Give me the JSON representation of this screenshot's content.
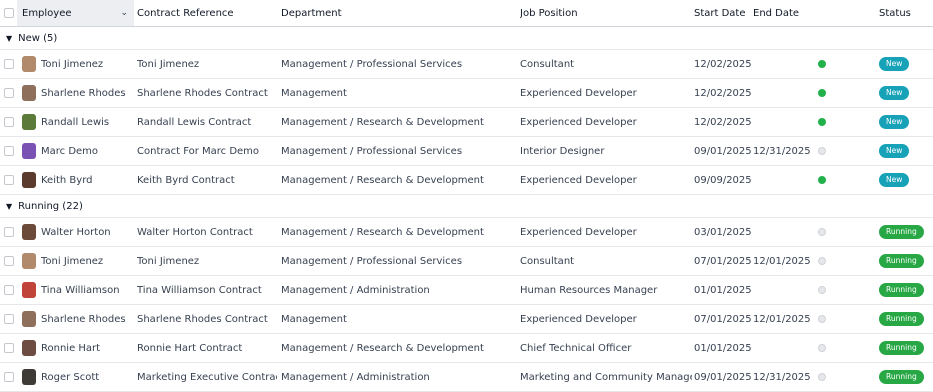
{
  "columns": {
    "employee": "Employee",
    "contract_reference": "Contract Reference",
    "department": "Department",
    "job_position": "Job Position",
    "start_date": "Start Date",
    "end_date": "End Date",
    "status": "Status"
  },
  "colors": {
    "new_badge": "#17a2b8",
    "running_badge": "#28a745",
    "dot_green": "#21b04a",
    "dot_grey": "#e5e7eb"
  },
  "groups": [
    {
      "label": "New (5)",
      "rows": [
        {
          "employee": "Toni Jimenez",
          "avatar_color": "#b08a6a",
          "contract": "Toni Jimenez",
          "department": "Management / Professional Services",
          "job": "Consultant",
          "start": "12/02/2025",
          "end": "",
          "kanban": "green",
          "status": "New"
        },
        {
          "employee": "Sharlene Rhodes",
          "avatar_color": "#8e6f5c",
          "contract": "Sharlene Rhodes Contract",
          "department": "Management",
          "job": "Experienced Developer",
          "start": "12/02/2025",
          "end": "",
          "kanban": "green",
          "status": "New"
        },
        {
          "employee": "Randall Lewis",
          "avatar_color": "#5c7a3a",
          "contract": "Randall Lewis Contract",
          "department": "Management / Research & Development",
          "job": "Experienced Developer",
          "start": "12/02/2025",
          "end": "",
          "kanban": "green",
          "status": "New"
        },
        {
          "employee": "Marc Demo",
          "avatar_color": "#7a52b3",
          "contract": "Contract For Marc Demo",
          "department": "Management / Professional Services",
          "job": "Interior Designer",
          "start": "09/01/2025",
          "end": "12/31/2025",
          "kanban": "grey",
          "status": "New"
        },
        {
          "employee": "Keith Byrd",
          "avatar_color": "#5a3b2e",
          "contract": "Keith Byrd Contract",
          "department": "Management / Research & Development",
          "job": "Experienced Developer",
          "start": "09/09/2025",
          "end": "",
          "kanban": "green",
          "status": "New"
        }
      ]
    },
    {
      "label": "Running (22)",
      "rows": [
        {
          "employee": "Walter Horton",
          "avatar_color": "#6b4a3a",
          "contract": "Walter Horton Contract",
          "department": "Management / Research & Development",
          "job": "Experienced Developer",
          "start": "03/01/2025",
          "end": "",
          "kanban": "grey",
          "status": "Running"
        },
        {
          "employee": "Toni Jimenez",
          "avatar_color": "#b08a6a",
          "contract": "Toni Jimenez",
          "department": "Management / Professional Services",
          "job": "Consultant",
          "start": "07/01/2025",
          "end": "12/01/2025",
          "kanban": "grey",
          "status": "Running"
        },
        {
          "employee": "Tina Williamson",
          "avatar_color": "#c0443a",
          "contract": "Tina Williamson Contract",
          "department": "Management / Administration",
          "job": "Human Resources Manager",
          "start": "01/01/2025",
          "end": "",
          "kanban": "grey",
          "status": "Running"
        },
        {
          "employee": "Sharlene Rhodes",
          "avatar_color": "#8e6f5c",
          "contract": "Sharlene Rhodes Contract",
          "department": "Management",
          "job": "Experienced Developer",
          "start": "07/01/2025",
          "end": "12/01/2025",
          "kanban": "grey",
          "status": "Running"
        },
        {
          "employee": "Ronnie Hart",
          "avatar_color": "#6d4c41",
          "contract": "Ronnie Hart Contract",
          "department": "Management / Research & Development",
          "job": "Chief Technical Officer",
          "start": "01/01/2025",
          "end": "",
          "kanban": "grey",
          "status": "Running"
        },
        {
          "employee": "Roger Scott",
          "avatar_color": "#3e3a36",
          "contract": "Marketing Executive Contract",
          "department": "Management / Administration",
          "job": "Marketing and Community Manager",
          "start": "09/01/2025",
          "end": "12/31/2025",
          "kanban": "grey",
          "status": "Running"
        }
      ]
    }
  ]
}
